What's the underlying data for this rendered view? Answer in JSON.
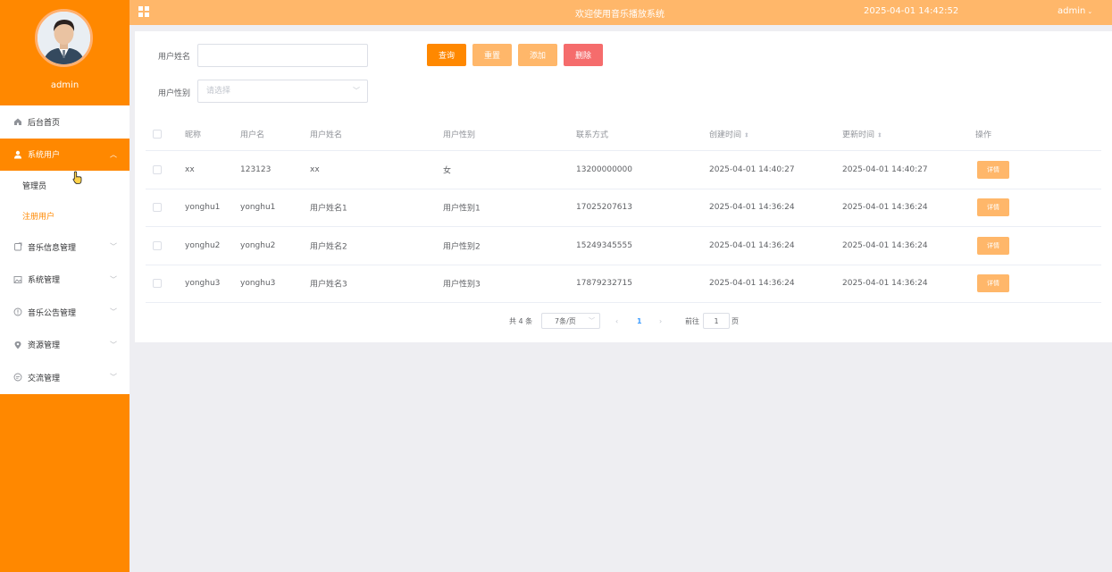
{
  "sidebar": {
    "username": "admin",
    "menu": {
      "home": "后台首页",
      "system_users": "系统用户",
      "sub_admin": "管理员",
      "sub_registered": "注册用户",
      "music_info": "音乐信息管理",
      "system_mgmt": "系统管理",
      "music_notice": "音乐公告管理",
      "resource": "资源管理",
      "communication": "交流管理"
    }
  },
  "header": {
    "title": "欢迎使用音乐播放系统",
    "datetime": "2025-04-01 14:42:52",
    "user": "admin"
  },
  "search": {
    "name_label": "用户姓名",
    "name_value": "",
    "gender_label": "用户性别",
    "gender_placeholder": "请选择"
  },
  "buttons": {
    "query": "查询",
    "reset": "重置",
    "add": "添加",
    "delete": "删除"
  },
  "table": {
    "columns": {
      "nickname": "昵称",
      "username": "用户名",
      "realname": "用户姓名",
      "gender": "用户性别",
      "contact": "联系方式",
      "created": "创建时间",
      "updated": "更新时间",
      "action": "操作"
    },
    "detail_label": "详情",
    "rows": [
      {
        "nickname": "xx",
        "username": "123123",
        "realname": "xx",
        "gender": "女",
        "contact": "13200000000",
        "created": "2025-04-01 14:40:27",
        "updated": "2025-04-01 14:40:27"
      },
      {
        "nickname": "yonghu1",
        "username": "yonghu1",
        "realname": "用户姓名1",
        "gender": "用户性别1",
        "contact": "17025207613",
        "created": "2025-04-01 14:36:24",
        "updated": "2025-04-01 14:36:24"
      },
      {
        "nickname": "yonghu2",
        "username": "yonghu2",
        "realname": "用户姓名2",
        "gender": "用户性别2",
        "contact": "15249345555",
        "created": "2025-04-01 14:36:24",
        "updated": "2025-04-01 14:36:24"
      },
      {
        "nickname": "yonghu3",
        "username": "yonghu3",
        "realname": "用户姓名3",
        "gender": "用户性别3",
        "contact": "17879232715",
        "created": "2025-04-01 14:36:24",
        "updated": "2025-04-01 14:36:24"
      }
    ]
  },
  "pagination": {
    "total": "共 4 条",
    "page_size": "7条/页",
    "prev": "‹",
    "current_page": "1",
    "next": "›",
    "goto_label": "前往",
    "goto_value": "1",
    "page_suffix": "页"
  },
  "colors": {
    "primary": "#ff8800",
    "light_primary": "#ffb76a",
    "danger": "#f56c6c",
    "active_page": "#409eff"
  }
}
